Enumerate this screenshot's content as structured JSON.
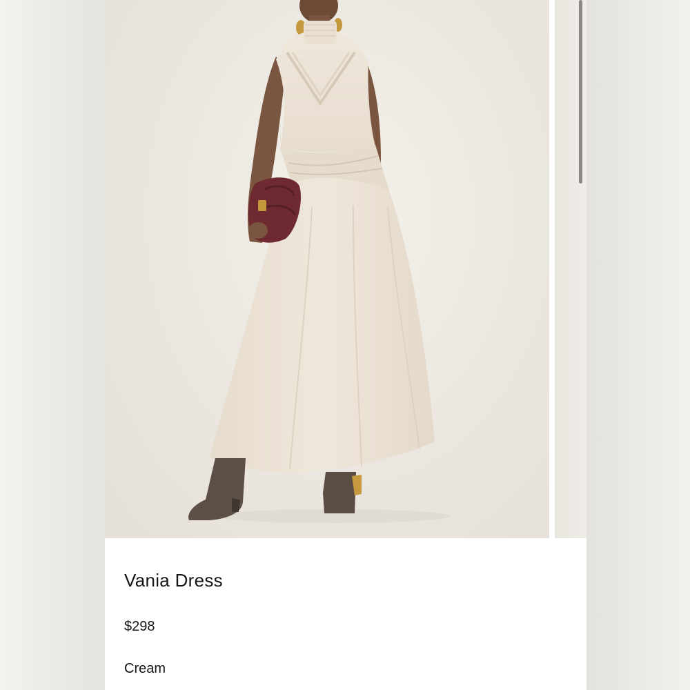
{
  "product": {
    "name": "Vania Dress",
    "price": "$298",
    "color": "Cream"
  },
  "gallery": {
    "main_image": "model-in-cream-maxi-dress-photo",
    "next_image": "next-product-photo-peek"
  },
  "colors": {
    "background": "#ffffff",
    "photo_background": "#ebe7e0",
    "dress": "#ece3d6",
    "bag": "#6e2a30",
    "boots": "#5a4d44",
    "text": "#161616"
  }
}
